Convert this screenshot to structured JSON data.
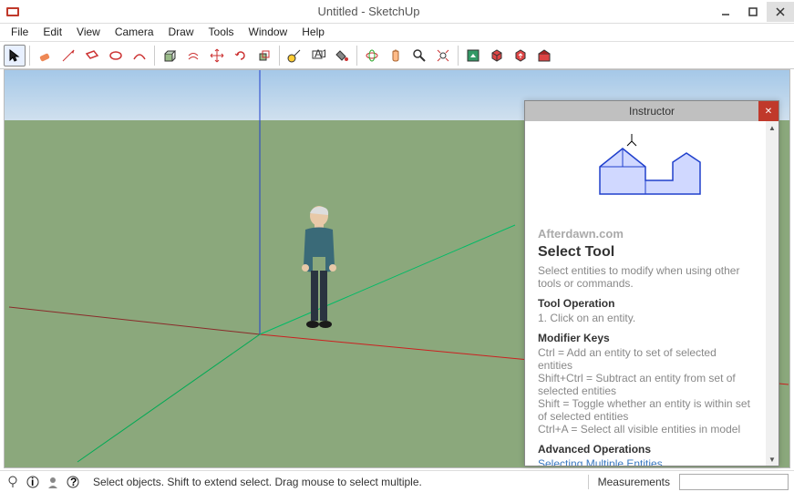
{
  "window": {
    "title": "Untitled - SketchUp"
  },
  "menu": [
    "File",
    "Edit",
    "View",
    "Camera",
    "Draw",
    "Tools",
    "Window",
    "Help"
  ],
  "instructor": {
    "title": "Instructor",
    "watermark": "Afterdawn.com",
    "tool_name": "Select Tool",
    "tool_desc": "Select entities to modify when using other tools or commands.",
    "op_head": "Tool Operation",
    "op_line": "1.   Click on an entity.",
    "mk_head": "Modifier Keys",
    "mk1": "Ctrl = Add an entity to set of selected entities",
    "mk2": "Shift+Ctrl = Subtract an entity from set of selected entities",
    "mk3": "Shift = Toggle whether an entity is within set of selected entities",
    "mk4": "Ctrl+A = Select all visible entities in model",
    "adv_head": "Advanced Operations",
    "adv_link": "Selecting Multiple Entities"
  },
  "status": {
    "hint": "Select objects. Shift to extend select. Drag mouse to select multiple.",
    "measure_label": "Measurements"
  }
}
